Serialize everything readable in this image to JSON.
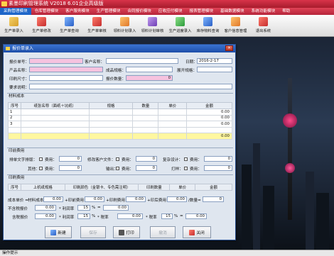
{
  "app": {
    "title": "素墨印刷管理系统    V2018  6.01企业高级版"
  },
  "menu": [
    "采购管理模块",
    "仓库管理模块",
    "客户服务模块",
    "生产管理模块",
    "合同报价模块",
    "应收应付模块",
    "报表管理模块",
    "基础数据模块",
    "系统功能模块",
    "帮助"
  ],
  "toolbar": [
    {
      "label": "生产单录入",
      "icon": "document-icon"
    },
    {
      "label": "生产单修改",
      "icon": "edit-icon"
    },
    {
      "label": "生产单查询",
      "icon": "search-icon"
    },
    {
      "label": "生产单审核",
      "icon": "audit-icon"
    },
    {
      "label": "领料计划录入",
      "icon": "material-icon"
    },
    {
      "label": "领料计划审核",
      "icon": "check-icon"
    },
    {
      "label": "生产进度录入",
      "icon": "progress-icon"
    },
    {
      "label": "库存物料查询",
      "icon": "inventory-icon"
    },
    {
      "label": "客户信息管理",
      "icon": "customer-icon"
    },
    {
      "label": "退出系统",
      "icon": "exit-icon"
    }
  ],
  "dialog": {
    "title": "报价单录入",
    "quote_no_label": "报价单号：",
    "customer_label": "客户名称：",
    "date_label": "日期：",
    "date_value": "2016-2-17",
    "product_label": "产品名称：",
    "finished_size_label": "成品规格：",
    "open_size_label": "展开规格：",
    "print_size_label": "印刷尺寸：",
    "quote_qty_label": "报价数量：",
    "quote_qty_value": "0",
    "requirement_label": "要求说明：",
    "material_section": "材料成本",
    "material_headers": [
      "序号",
      "纸张名称（面纸＋坑纸）",
      "规格",
      "数量",
      "单价",
      "金额"
    ],
    "material_rows": [
      {
        "no": "1",
        "amount": "0.00"
      },
      {
        "no": "2",
        "amount": "0.00"
      },
      {
        "no": "3",
        "amount": "0.00"
      }
    ],
    "material_total": "0.00",
    "print_cost_section": "印前费用",
    "prepress": {
      "typesetting_label": "排单文字排版：",
      "fee_label": "费用：",
      "modify_label": "修改客户文件：",
      "complex_label": "复杂设计：",
      "other_label": "其他：",
      "output_label": "输出：",
      "proof_label": "打样：",
      "zero": "0",
      "zero2": "0.00"
    },
    "print_fee_section": "印刷费用",
    "print_headers": [
      "序号",
      "上机纸规格",
      "印刷颜色（金银卡、专色需注明）",
      "印刷数量",
      "单价",
      "金额"
    ],
    "calc": {
      "cost_unit_label": "成本单价 =",
      "material_cost_label": "材料成本",
      "plus_prepress": "+印前费用",
      "plus_print": "+印刷费用",
      "plus_post": "+印后费用",
      "div_qty": "/数量=",
      "v_000": "0.00",
      "v_0": "0",
      "v_15": "15",
      "pct": "%",
      "excl_tax_label": "不含税报价",
      "incl_tax_label": "含税报价",
      "profit_label": "* 利润率",
      "tax_label": "* 税率",
      "eq": "="
    },
    "buttons": {
      "new": "新建",
      "save": "保存",
      "print": "打印",
      "cancel": "撤消",
      "close": "关闭"
    }
  },
  "status": "操作提示"
}
